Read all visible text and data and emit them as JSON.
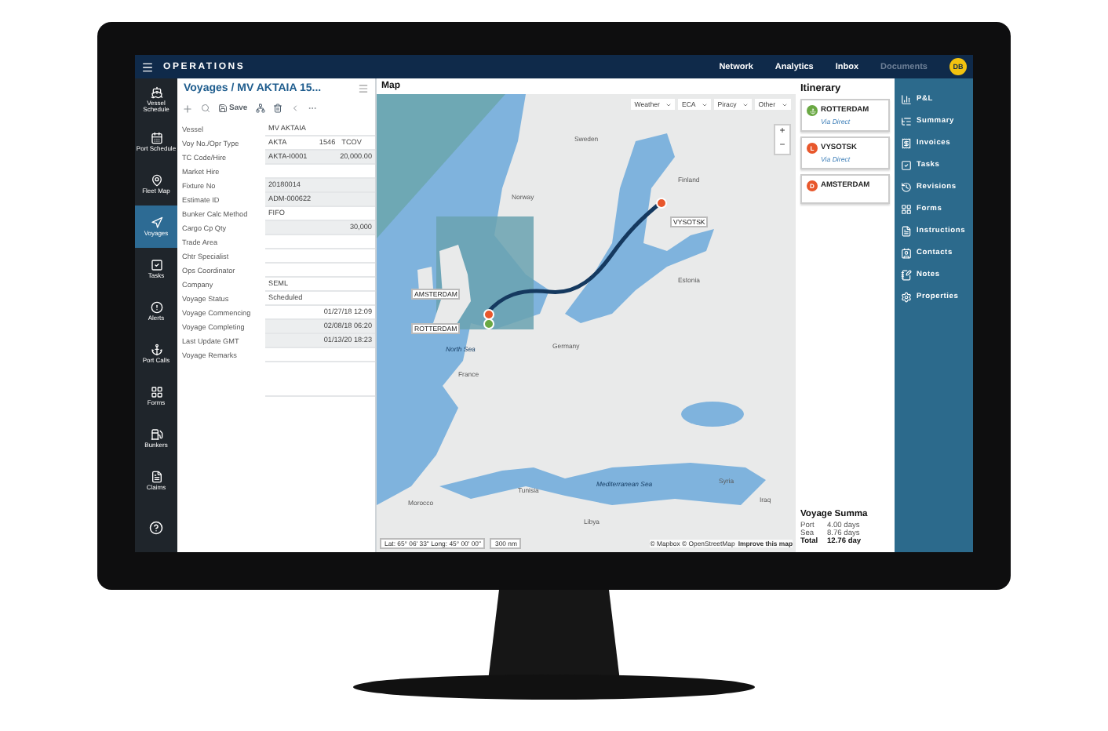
{
  "app_bar": {
    "title": "OPERATIONS",
    "nav": [
      {
        "label": "Network",
        "disabled": false
      },
      {
        "label": "Analytics",
        "disabled": false
      },
      {
        "label": "Inbox",
        "disabled": false
      },
      {
        "label": "Documents",
        "disabled": true
      }
    ],
    "avatar": "DB"
  },
  "sidebar": {
    "items": [
      {
        "label": "Vessel Schedule",
        "selected": false
      },
      {
        "label": "Port Schedule",
        "selected": false
      },
      {
        "label": "Fleet Map",
        "selected": false
      },
      {
        "label": "Voyages",
        "selected": true
      },
      {
        "label": "Tasks",
        "selected": false
      },
      {
        "label": "Alerts",
        "selected": false
      },
      {
        "label": "Port Calls",
        "selected": false
      },
      {
        "label": "Forms",
        "selected": false
      },
      {
        "label": "Bunkers",
        "selected": false
      },
      {
        "label": "Claims",
        "selected": false
      }
    ]
  },
  "voyage_panel": {
    "breadcrumb_root": "Voyages",
    "breadcrumb_title": "/ MV AKTAIA 15...",
    "save_label": "Save",
    "fields": [
      {
        "label": "Vessel",
        "readonly": false,
        "values": [
          {
            "text": "MV AKTAIA",
            "kind": "text"
          }
        ]
      },
      {
        "label": "Voy No./Opr Type",
        "readonly": false,
        "values": [
          {
            "text": "AKTA",
            "kind": "text"
          },
          {
            "text": "1546",
            "kind": "number"
          },
          {
            "text": "TCOV",
            "kind": "text"
          }
        ]
      },
      {
        "label": "TC Code/Hire",
        "readonly": true,
        "values": [
          {
            "text": "AKTA-I0001",
            "kind": "text"
          },
          {
            "text": "20,000.00",
            "kind": "number"
          }
        ]
      },
      {
        "label": "Market Hire",
        "readonly": false
      },
      {
        "label": "Fixture No",
        "readonly": true,
        "values": [
          {
            "text": "20180014",
            "kind": "text"
          }
        ]
      },
      {
        "label": "Estimate ID",
        "readonly": true,
        "values": [
          {
            "text": "ADM-000622",
            "kind": "text"
          }
        ]
      },
      {
        "label": "Bunker Calc Method",
        "readonly": false,
        "values": [
          {
            "text": "FIFO",
            "kind": "text"
          }
        ]
      },
      {
        "label": "Cargo Cp Qty",
        "readonly": true,
        "values": [
          {
            "text": "30,000",
            "kind": "number"
          }
        ]
      },
      {
        "label": "Trade Area",
        "readonly": false
      },
      {
        "label": "Chtr Specialist",
        "readonly": false
      },
      {
        "label": "Ops Coordinator",
        "readonly": false
      },
      {
        "label": "Company",
        "readonly": false,
        "values": [
          {
            "text": "SEML",
            "kind": "text"
          }
        ]
      },
      {
        "label": "Voyage Status",
        "readonly": false,
        "values": [
          {
            "text": "Scheduled",
            "kind": "text"
          }
        ]
      },
      {
        "label": "Voyage Commencing",
        "readonly": false,
        "values": [
          {
            "text": "01/27/18 12:09",
            "kind": "number"
          }
        ]
      },
      {
        "label": "Voyage Completing",
        "readonly": true,
        "values": [
          {
            "text": "02/08/18 06:20",
            "kind": "number"
          }
        ]
      },
      {
        "label": "Last Update GMT",
        "readonly": true,
        "values": [
          {
            "text": "01/13/20 18:23",
            "kind": "number"
          }
        ]
      },
      {
        "label": "Voyage Remarks",
        "readonly": false
      }
    ]
  },
  "map": {
    "title": "Map",
    "filters": [
      "Weather",
      "ECA",
      "Piracy",
      "Other"
    ],
    "zoom_in": "+",
    "zoom_out": "−",
    "places": [
      "Sweden",
      "Finland",
      "Norway",
      "North Sea",
      "Estonia",
      "Germany",
      "France",
      "Mediterranean Sea",
      "Morocco",
      "Tunisia",
      "Libya",
      "Syria",
      "Iraq"
    ],
    "ports": [
      {
        "name": "VYSOTSK",
        "color": "#e8572c"
      },
      {
        "name": "AMSTERDAM",
        "color": "#e8572c"
      },
      {
        "name": "ROTTERDAM",
        "color": "#6aa843"
      }
    ],
    "coordinates": "Lat: 65° 06' 33\" Long: 45° 00' 00\"",
    "scale": "300 nm",
    "attribution": "© Mapbox © OpenStreetMap",
    "improve_link": "Improve this map"
  },
  "itinerary": {
    "title": "Itinerary",
    "stops": [
      {
        "name": "ROTTERDAM",
        "color": "#6aa843",
        "via": "Via Direct"
      },
      {
        "name": "VYSOTSK",
        "color": "#e8572c",
        "badge": "L",
        "via": "Via Direct"
      },
      {
        "name": "AMSTERDAM",
        "color": "#e8572c",
        "badge": "D"
      }
    ],
    "summary": {
      "title": "Voyage Summa",
      "rows": [
        {
          "label": "Port",
          "value": "4.00 days",
          "total": false
        },
        {
          "label": "Sea",
          "value": "8.76 days",
          "total": false
        },
        {
          "label": "Total",
          "value": "12.76 day",
          "total": true
        }
      ]
    }
  },
  "right_panel": {
    "items": [
      {
        "label": "P&L"
      },
      {
        "label": "Summary"
      },
      {
        "label": "Invoices"
      },
      {
        "label": "Tasks"
      },
      {
        "label": "Revisions"
      },
      {
        "label": "Forms"
      },
      {
        "label": "Instructions"
      },
      {
        "label": "Contacts"
      },
      {
        "label": "Notes"
      },
      {
        "label": "Properties"
      }
    ]
  }
}
